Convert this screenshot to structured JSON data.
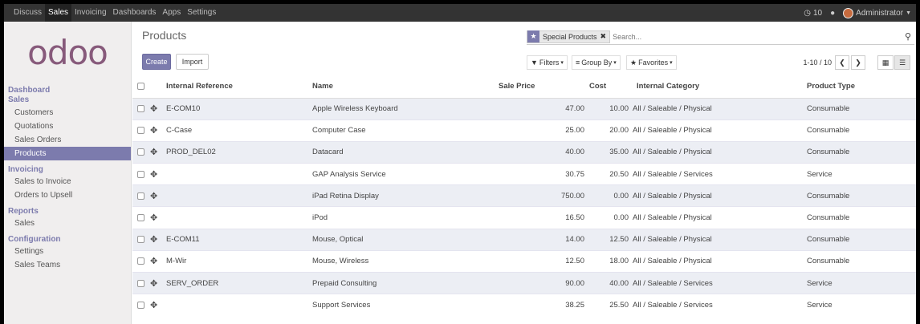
{
  "topbar": {
    "menu": [
      "Discuss",
      "Sales",
      "Invoicing",
      "Dashboards",
      "Apps",
      "Settings"
    ],
    "active_menu": "Sales",
    "messages": "10",
    "user": "Administrator"
  },
  "logo": "odoo",
  "sidebar": {
    "dashboard": "Dashboard",
    "sales_section": "Sales",
    "sales_items": [
      "Customers",
      "Quotations",
      "Sales Orders",
      "Products"
    ],
    "invoicing_section": "Invoicing",
    "invoicing_items": [
      "Sales to Invoice",
      "Orders to Upsell"
    ],
    "reports_section": "Reports",
    "reports_items": [
      "Sales"
    ],
    "configuration_section": "Configuration",
    "configuration_items": [
      "Settings",
      "Sales Teams"
    ]
  },
  "control_panel": {
    "title": "Products",
    "create_label": "Create",
    "import_label": "Import",
    "facet_label": "Special Products",
    "search_placeholder": "Search...",
    "filters_label": "Filters",
    "group_by_label": "Group By",
    "favorites_label": "Favorites",
    "pager": "1-10 / 10"
  },
  "table": {
    "headers": [
      "Internal Reference",
      "Name",
      "Sale Price",
      "Cost",
      "Internal Category",
      "Product Type"
    ],
    "rows": [
      {
        "ref": "E-COM10",
        "name": "Apple Wireless Keyboard",
        "price": "47.00",
        "cost": "10.00",
        "category": "All / Saleable / Physical",
        "type": "Consumable"
      },
      {
        "ref": "C-Case",
        "name": "Computer Case",
        "price": "25.00",
        "cost": "20.00",
        "category": "All / Saleable / Physical",
        "type": "Consumable"
      },
      {
        "ref": "PROD_DEL02",
        "name": "Datacard",
        "price": "40.00",
        "cost": "35.00",
        "category": "All / Saleable / Physical",
        "type": "Consumable"
      },
      {
        "ref": "",
        "name": "GAP Analysis Service",
        "price": "30.75",
        "cost": "20.50",
        "category": "All / Saleable / Services",
        "type": "Service"
      },
      {
        "ref": "",
        "name": "iPad Retina Display",
        "price": "750.00",
        "cost": "0.00",
        "category": "All / Saleable / Physical",
        "type": "Consumable"
      },
      {
        "ref": "",
        "name": "iPod",
        "price": "16.50",
        "cost": "0.00",
        "category": "All / Saleable / Physical",
        "type": "Consumable"
      },
      {
        "ref": "E-COM11",
        "name": "Mouse, Optical",
        "price": "14.00",
        "cost": "12.50",
        "category": "All / Saleable / Physical",
        "type": "Consumable"
      },
      {
        "ref": "M-Wir",
        "name": "Mouse, Wireless",
        "price": "12.50",
        "cost": "18.00",
        "category": "All / Saleable / Physical",
        "type": "Consumable"
      },
      {
        "ref": "SERV_ORDER",
        "name": "Prepaid Consulting",
        "price": "90.00",
        "cost": "40.00",
        "category": "All / Saleable / Services",
        "type": "Service"
      },
      {
        "ref": "",
        "name": "Support Services",
        "price": "38.25",
        "cost": "25.50",
        "category": "All / Saleable / Services",
        "type": "Service"
      }
    ]
  },
  "colors": {
    "brand": "#875a7b",
    "accent": "#7c7bad",
    "topbar": "#333333"
  }
}
